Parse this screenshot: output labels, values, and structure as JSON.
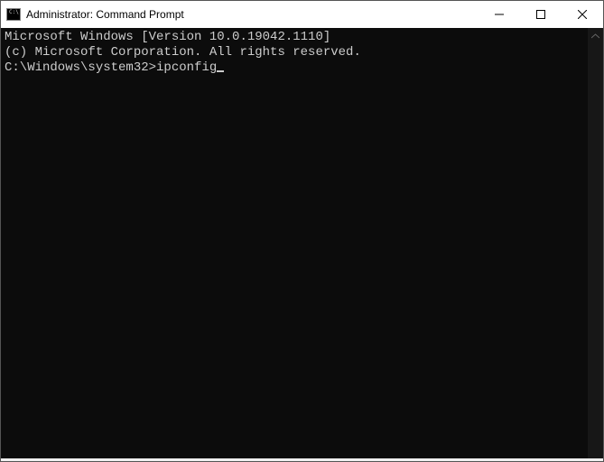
{
  "window": {
    "title": "Administrator: Command Prompt",
    "icon_label": "C:\\"
  },
  "terminal": {
    "version_line": "Microsoft Windows [Version 10.0.19042.1110]",
    "copyright_line": "(c) Microsoft Corporation. All rights reserved.",
    "blank_line": "",
    "prompt": "C:\\Windows\\system32>",
    "command": "ipconfig"
  }
}
